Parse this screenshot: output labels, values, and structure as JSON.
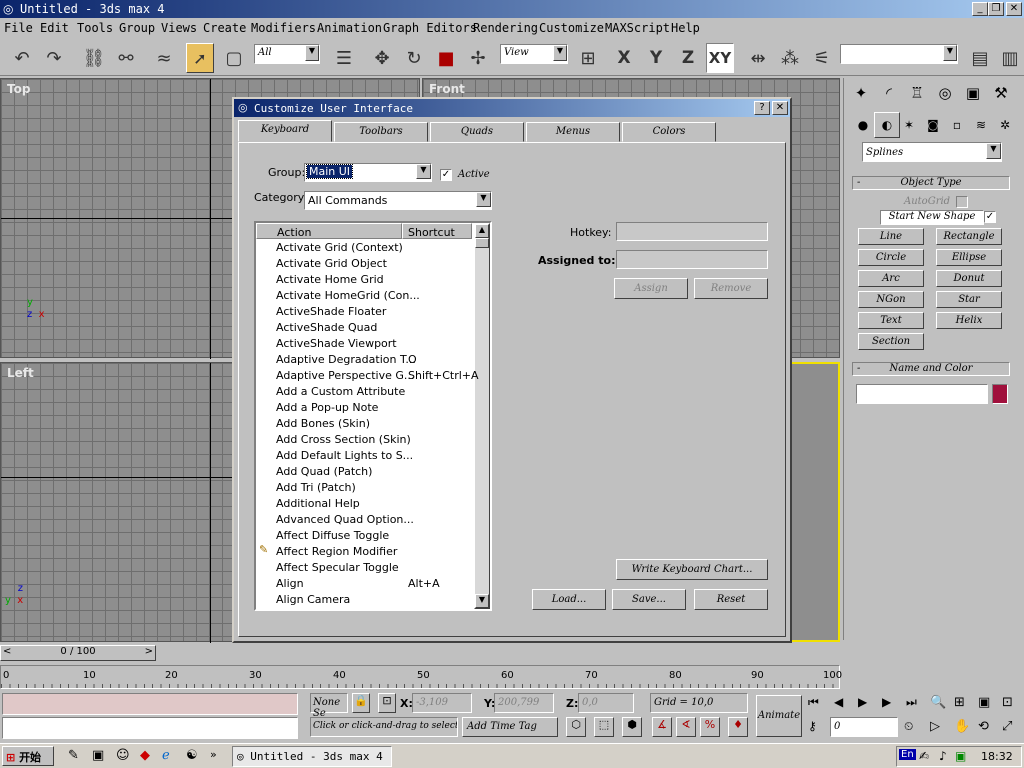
{
  "app": {
    "title": "Untitled - 3ds max 4"
  },
  "menu": [
    "File",
    "Edit",
    "Tools",
    "Group",
    "Views",
    "Create",
    "Modifiers",
    "Animation",
    "Graph Editors",
    "Rendering",
    "Customize",
    "MAXScript",
    "Help"
  ],
  "toolbar": {
    "selection_filter": "All",
    "reference_coord": "View",
    "axis_x": "X",
    "axis_y": "Y",
    "axis_z": "Z",
    "axis_xy": "XY"
  },
  "viewports": {
    "top": "Top",
    "front": "Front",
    "left": "Left"
  },
  "dialog": {
    "title": "Customize User Interface",
    "tabs": [
      "Keyboard",
      "Toolbars",
      "Quads",
      "Menus",
      "Colors"
    ],
    "group_label": "Group:",
    "group_value": "Main UI",
    "active_label": "Active",
    "category_label": "Category:",
    "category_value": "All Commands",
    "col_action": "Action",
    "col_shortcut": "Shortcut",
    "actions": [
      {
        "a": "Activate Grid (Context)",
        "s": ""
      },
      {
        "a": "Activate Grid Object",
        "s": ""
      },
      {
        "a": "Activate Home Grid",
        "s": ""
      },
      {
        "a": "Activate HomeGrid (Con...",
        "s": ""
      },
      {
        "a": "ActiveShade Floater",
        "s": ""
      },
      {
        "a": "ActiveShade Quad",
        "s": ""
      },
      {
        "a": "ActiveShade Viewport",
        "s": ""
      },
      {
        "a": "Adaptive Degradation T...",
        "s": "O"
      },
      {
        "a": "Adaptive Perspective G...",
        "s": "Shift+Ctrl+A"
      },
      {
        "a": "Add a Custom Attribute",
        "s": ""
      },
      {
        "a": "Add a Pop-up Note",
        "s": ""
      },
      {
        "a": "Add Bones (Skin)",
        "s": ""
      },
      {
        "a": "Add Cross Section (Skin)",
        "s": ""
      },
      {
        "a": "Add Default Lights to S...",
        "s": ""
      },
      {
        "a": "Add Quad (Patch)",
        "s": ""
      },
      {
        "a": "Add Tri (Patch)",
        "s": ""
      },
      {
        "a": "Additional Help",
        "s": ""
      },
      {
        "a": "Advanced Quad Option...",
        "s": ""
      },
      {
        "a": "Affect Diffuse Toggle",
        "s": ""
      },
      {
        "a": "Affect Region Modifier",
        "s": ""
      },
      {
        "a": "Affect Specular Toggle",
        "s": ""
      },
      {
        "a": "Align",
        "s": "Alt+A"
      },
      {
        "a": "Align Camera",
        "s": ""
      }
    ],
    "hotkey_label": "Hotkey:",
    "assigned_label": "Assigned to:",
    "assign": "Assign",
    "remove": "Remove",
    "write_chart": "Write Keyboard Chart...",
    "load": "Load...",
    "save": "Save...",
    "reset": "Reset"
  },
  "command_panel": {
    "category": "Splines",
    "rollout_object_type": "Object Type",
    "autogrid": "AutoGrid",
    "start_new_shape": "Start New Shape",
    "shapes": [
      "Line",
      "Rectangle",
      "Circle",
      "Ellipse",
      "Arc",
      "Donut",
      "NGon",
      "Star",
      "Text",
      "Helix",
      "Section"
    ],
    "rollout_name_color": "Name and Color",
    "swatch_color": "#a0103c"
  },
  "timeline": {
    "slider": "0 / 100",
    "ticks": [
      "0",
      "10",
      "20",
      "30",
      "40",
      "50",
      "60",
      "70",
      "80",
      "90",
      "100"
    ]
  },
  "status": {
    "none_selected": "None Se",
    "x_label": "X:",
    "x_value": "-3,109",
    "y_label": "Y:",
    "y_value": "200,799",
    "z_label": "Z:",
    "z_value": "0,0",
    "grid": "Grid = 10,0",
    "prompt": "Click or click-and-drag to select",
    "add_time_tag": "Add Time Tag",
    "animate": "Animate",
    "frame": "0"
  },
  "taskbar": {
    "start": "开始",
    "task": "Untitled - 3ds max 4",
    "clock": "18:32",
    "lang": "En"
  }
}
